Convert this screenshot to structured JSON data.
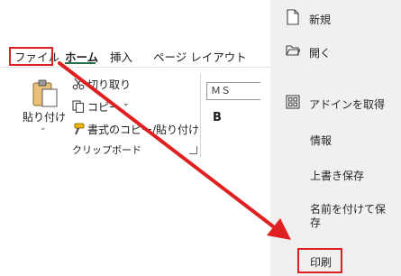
{
  "ribbon": {
    "tabs": [
      {
        "label": "ファイル"
      },
      {
        "label": "ホーム"
      },
      {
        "label": "挿入"
      },
      {
        "label": "ページ レイアウト"
      }
    ],
    "clipboard": {
      "paste_label": "貼り付け",
      "cut_label": "切り取り",
      "copy_label": "コピー",
      "format_painter_label": "書式のコピー/貼り付け",
      "group_label": "クリップボード"
    },
    "font": {
      "font_name": "ＭＳ",
      "bold_label": "B"
    }
  },
  "backstage": {
    "items": [
      {
        "label": "新規",
        "icon": "new-document-icon"
      },
      {
        "label": "開く",
        "icon": "open-folder-icon"
      },
      {
        "label": "アドインを取得",
        "icon": "add-ins-icon"
      },
      {
        "label": "情報"
      },
      {
        "label": "上書き保存"
      },
      {
        "label": "名前を付けて保\n存"
      },
      {
        "label": "印刷"
      }
    ]
  },
  "colors": {
    "highlight": "#e02020",
    "backstage_bg": "#f0f0f0",
    "accent": "#217346"
  }
}
